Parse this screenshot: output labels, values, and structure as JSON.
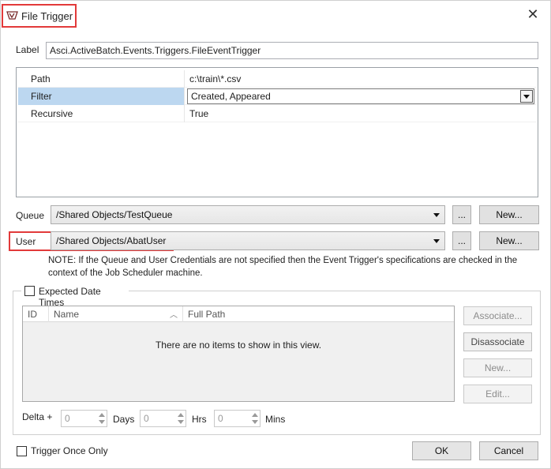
{
  "window": {
    "title": "File Trigger",
    "close_icon": "close-icon",
    "app_icon": "file-trigger-icon"
  },
  "label_field": {
    "label": "Label",
    "value": "Asci.ActiveBatch.Events.Triggers.FileEventTrigger"
  },
  "properties": [
    {
      "name": "Path",
      "value": "c:\\train\\*.csv"
    },
    {
      "name": "Filter",
      "value": "Created, Appeared"
    },
    {
      "name": "Recursive",
      "value": "True"
    }
  ],
  "queue": {
    "label": "Queue",
    "value": "/Shared Objects/TestQueue",
    "browse_label": "...",
    "new_label": "New..."
  },
  "user": {
    "label": "User",
    "value": "/Shared Objects/AbatUser",
    "browse_label": "...",
    "new_label": "New..."
  },
  "note": "NOTE: If the Queue and User Credentials are not specified then the Event Trigger's specifications are checked in the context of the Job Scheduler machine.",
  "expected_dates": {
    "checkbox_label": "Expected Date Times",
    "checked": false,
    "columns": [
      "ID",
      "Name",
      "Full Path"
    ],
    "empty_text": "There are no items to show in this view.",
    "buttons": {
      "associate": "Associate...",
      "disassociate": "Disassociate",
      "new": "New...",
      "edit": "Edit..."
    },
    "delta": {
      "label": "Delta +",
      "days_value": "0",
      "days_label": "Days",
      "hrs_value": "0",
      "hrs_label": "Hrs",
      "mins_value": "0",
      "mins_label": "Mins"
    }
  },
  "footer": {
    "trigger_once_label": "Trigger Once Only",
    "trigger_once_checked": false,
    "ok_label": "OK",
    "cancel_label": "Cancel"
  },
  "colors": {
    "highlight": "#e23a3a",
    "selection": "#bcd7f0"
  }
}
